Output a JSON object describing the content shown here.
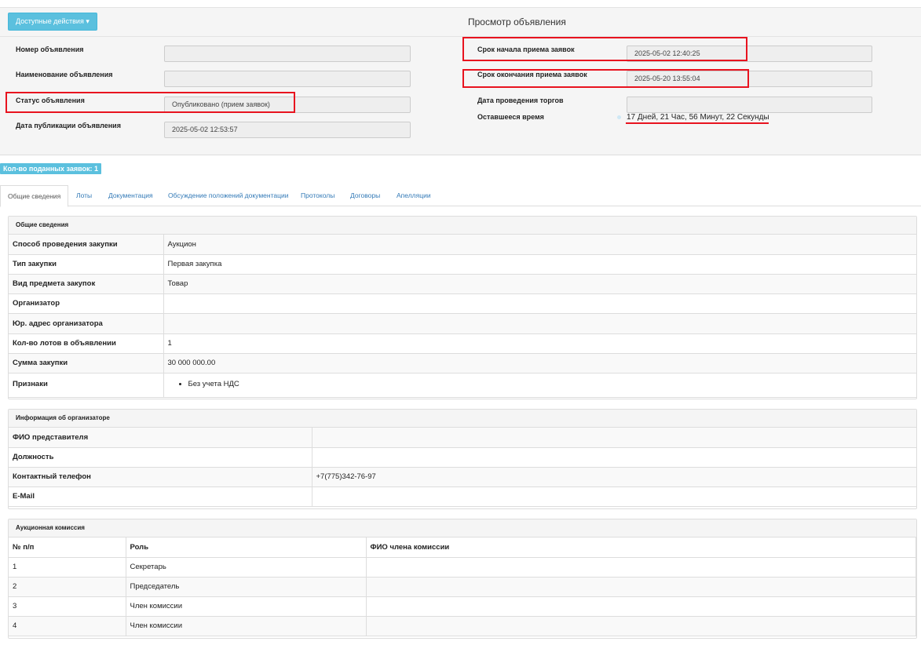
{
  "header": {
    "actions_label": "Доступные действия",
    "title": "Просмотр объявления"
  },
  "info": {
    "number_label": "Номер объявления",
    "number_value": "",
    "name_label": "Наименование объявления",
    "name_value": "",
    "status_label": "Статус объявления",
    "status_value": "Опубликовано (прием заявок)",
    "pub_date_label": "Дата публикации объявления",
    "pub_date_value": "2025-05-02 12:53:57",
    "start_label": "Срок начала приема заявок",
    "start_value": "2025-05-02 12:40:25",
    "end_label": "Срок окончания приема заявок",
    "end_value": "2025-05-20 13:55:04",
    "auction_date_label": "Дата проведения торгов",
    "auction_date_value": "",
    "remaining_label": "Оставшееся время",
    "remaining_value": "17 Дней, 21 Час, 56 Минут, 22 Секунды"
  },
  "badge": "Кол-во поданных заявок: 1",
  "tabs": [
    "Общие сведения",
    "Лоты",
    "Документация",
    "Обсуждение положений документации",
    "Протоколы",
    "Договоры",
    "Апелляции"
  ],
  "general": {
    "title": "Общие сведения",
    "rows": [
      {
        "k": "Способ проведения закупки",
        "v": "Аукцион"
      },
      {
        "k": "Тип закупки",
        "v": "Первая закупка"
      },
      {
        "k": "Вид предмета закупок",
        "v": "Товар"
      },
      {
        "k": "Организатор",
        "v": ""
      },
      {
        "k": "Юр. адрес организатора",
        "v": ""
      },
      {
        "k": "Кол-во лотов в объявлении",
        "v": "1"
      },
      {
        "k": "Сумма закупки",
        "v": "30 000 000.00"
      },
      {
        "k": "Признаки",
        "v": "Без учета НДС"
      }
    ]
  },
  "organizer": {
    "title": "Информация об организаторе",
    "rows": [
      {
        "k": "ФИО представителя",
        "v": ""
      },
      {
        "k": "Должность",
        "v": ""
      },
      {
        "k": "Контактный телефон",
        "v": "+7(775)342-76-97"
      },
      {
        "k": "E-Mail",
        "v": ""
      }
    ]
  },
  "commission": {
    "title": "Аукционная комиссия",
    "headers": [
      "№ п/п",
      "Роль",
      "ФИО члена комиссии"
    ],
    "rows": [
      {
        "n": "1",
        "role": "Секретарь",
        "fio": ""
      },
      {
        "n": "2",
        "role": "Председатель",
        "fio": ""
      },
      {
        "n": "3",
        "role": "Член комиссии",
        "fio": ""
      },
      {
        "n": "4",
        "role": "Член комиссии",
        "fio": ""
      }
    ]
  }
}
